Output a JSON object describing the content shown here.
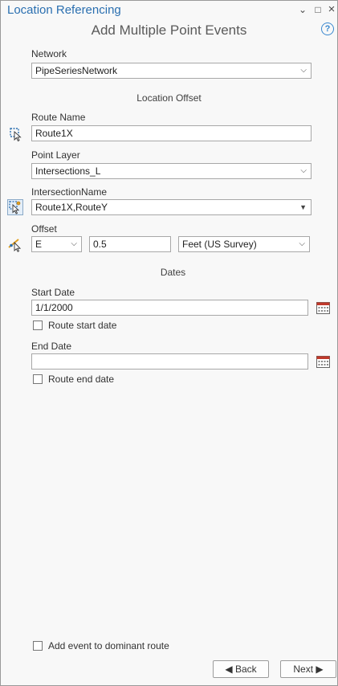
{
  "pane": {
    "title": "Location Referencing",
    "tool_title": "Add Multiple Point Events"
  },
  "controls": {
    "menu_glyph": "⌄",
    "maximize_glyph": "□",
    "close_glyph": "×",
    "help_glyph": "?"
  },
  "network": {
    "label": "Network",
    "value": "PipeSeriesNetwork"
  },
  "location_offset": {
    "section_label": "Location Offset",
    "route_name_label": "Route Name",
    "route_name_value": "Route1X",
    "point_layer_label": "Point Layer",
    "point_layer_value": "Intersections_L",
    "intersection_name_label": "IntersectionName",
    "intersection_name_value": "Route1X,RouteY",
    "offset_label": "Offset",
    "offset_direction": "E",
    "offset_value": "0.5",
    "offset_units": "Feet (US Survey)"
  },
  "dates": {
    "section_label": "Dates",
    "start_date_label": "Start Date",
    "start_date_value": "1/1/2000",
    "route_start_date_label": "Route start date",
    "route_start_date_checked": false,
    "end_date_label": "End Date",
    "end_date_value": "",
    "route_end_date_label": "Route end date",
    "route_end_date_checked": false
  },
  "footer": {
    "dominant_route_label": "Add event to dominant route",
    "dominant_route_checked": false,
    "back_label": "◀ Back",
    "next_label": "Next ▶"
  },
  "icons": {
    "menu": "chevron-down-icon",
    "maximize": "maximize-icon",
    "close": "close-icon",
    "help": "help-icon",
    "route_select": "select-route-from-map-icon",
    "intersection_select": "select-intersection-from-map-icon",
    "offset_select": "select-offset-from-map-icon",
    "calendar": "calendar-icon",
    "dropdown": "dropdown-arrow-icon"
  },
  "colors": {
    "title_blue": "#2a6fb0",
    "help_blue": "#3a88cf",
    "background": "#f8f8f8"
  }
}
